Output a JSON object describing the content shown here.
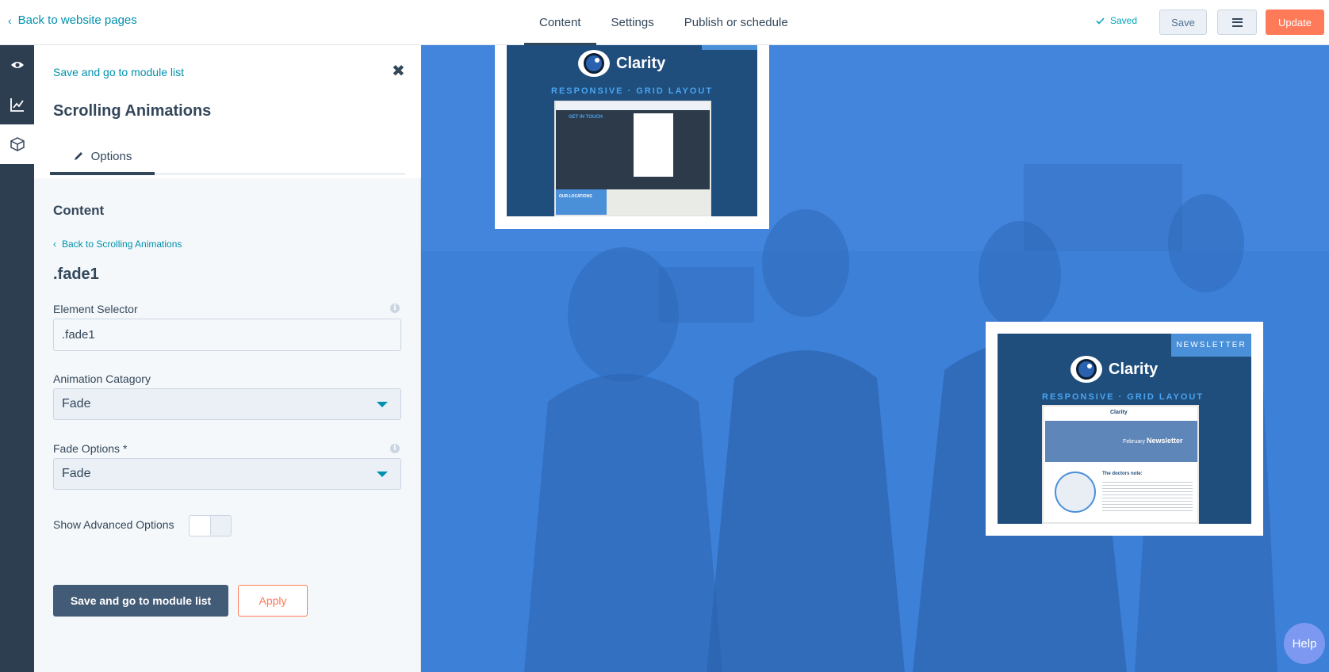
{
  "topbar": {
    "back_label": "Back to website pages",
    "tabs": [
      {
        "label": "Content",
        "active": true
      },
      {
        "label": "Settings",
        "active": false
      },
      {
        "label": "Publish or schedule",
        "active": false
      }
    ],
    "saved_label": "Saved",
    "save_label": "Save",
    "update_label": "Update"
  },
  "rail": {
    "items": [
      {
        "icon": "eye-icon"
      },
      {
        "icon": "analytics-chart-icon"
      },
      {
        "icon": "module-box-icon",
        "active": true
      }
    ]
  },
  "panel": {
    "save_go_link": "Save and go to module list",
    "module_title": "Scrolling Animations",
    "options_tab": "Options",
    "content_label": "Content",
    "back_link": "Back to Scrolling Animations",
    "item_name": ".fade1",
    "fields": {
      "element_selector": {
        "label": "Element Selector",
        "value": ".fade1"
      },
      "animation_category": {
        "label": "Animation Catagory",
        "value": "Fade"
      },
      "fade_options": {
        "label": "Fade Options *",
        "value": "Fade"
      },
      "show_advanced": {
        "label": "Show Advanced Options",
        "on": false
      }
    },
    "primary_button": "Save and go to module list",
    "apply_button": "Apply"
  },
  "preview": {
    "card1": {
      "brand": "Clarity",
      "tagline": "RESPONSIVE · GRID LAYOUT",
      "shot_heading": "GET IN TOUCH",
      "shot_sub": "OUR LOCATIONS"
    },
    "card2": {
      "badge": "NEWSLETTER",
      "brand": "Clarity",
      "tagline": "RESPONSIVE · GRID LAYOUT",
      "shot_brand": "Clarity",
      "shot_banner_small": "February",
      "shot_banner_big": "Newsletter",
      "shot_note": "The doctors note:"
    }
  },
  "help_label": "Help",
  "colors": {
    "accent": "#0091ae",
    "update": "#ff7a59",
    "primary": "#425b76",
    "rail": "#2d3e50",
    "preview_overlay": "#3b7fd6"
  }
}
